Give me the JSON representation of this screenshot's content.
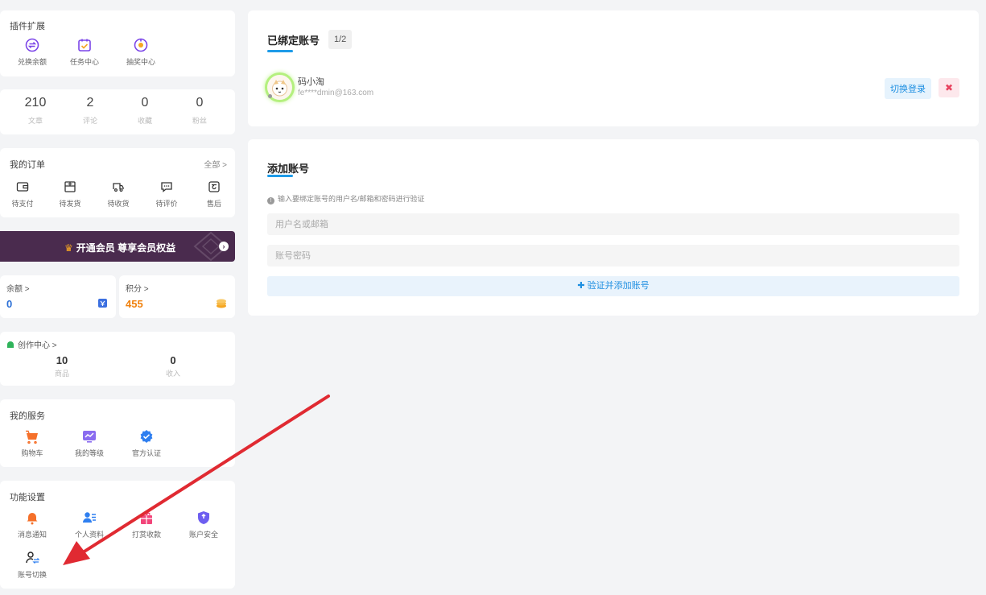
{
  "plugins": {
    "title": "插件扩展",
    "items": [
      {
        "label": "兑换余额",
        "icon": "exchange-icon"
      },
      {
        "label": "任务中心",
        "icon": "calendar-check-icon"
      },
      {
        "label": "抽奖中心",
        "icon": "lottery-icon"
      }
    ]
  },
  "stats": [
    {
      "value": "210",
      "label": "文章"
    },
    {
      "value": "2",
      "label": "评论"
    },
    {
      "value": "0",
      "label": "收藏"
    },
    {
      "value": "0",
      "label": "粉丝"
    }
  ],
  "orders": {
    "title": "我的订单",
    "all_label": "全部 >",
    "items": [
      {
        "label": "待支付",
        "icon": "wallet-icon"
      },
      {
        "label": "待发货",
        "icon": "box-icon"
      },
      {
        "label": "待收货",
        "icon": "truck-icon"
      },
      {
        "label": "待评价",
        "icon": "comment-icon"
      },
      {
        "label": "售后",
        "icon": "return-icon"
      }
    ]
  },
  "vip": {
    "label": "开通会员 尊享会员权益"
  },
  "balance": {
    "label": "余额 >",
    "value": "0"
  },
  "points": {
    "label": "积分 >",
    "value": "455"
  },
  "creator": {
    "title": "创作中心 >",
    "items": [
      {
        "value": "10",
        "label": "商品"
      },
      {
        "value": "0",
        "label": "收入"
      }
    ]
  },
  "services": {
    "title": "我的服务",
    "items": [
      {
        "label": "购物车",
        "icon": "cart-icon"
      },
      {
        "label": "我的等级",
        "icon": "level-chart-icon"
      },
      {
        "label": "官方认证",
        "icon": "verified-icon"
      }
    ]
  },
  "settings": {
    "title": "功能设置",
    "items": [
      {
        "label": "消息通知",
        "icon": "bell-icon"
      },
      {
        "label": "个人资料",
        "icon": "profile-icon"
      },
      {
        "label": "打赏收款",
        "icon": "gift-icon"
      },
      {
        "label": "账户安全",
        "icon": "shield-icon"
      },
      {
        "label": "账号切换",
        "icon": "switch-user-icon"
      }
    ]
  },
  "bound": {
    "title": "已绑定账号",
    "count": "1/2",
    "account": {
      "name": "码小淘",
      "email": "fe****dmin@163.com"
    },
    "switch_label": "切换登录",
    "delete_label": "✖"
  },
  "add": {
    "title": "添加账号",
    "hint": "输入要绑定账号的用户名/邮箱和密码进行验证",
    "username_placeholder": "用户名或邮箱",
    "password_placeholder": "账号密码",
    "submit_label": "✚ 验证并添加账号"
  },
  "colors": {
    "accent": "#1e9be8",
    "vip_bg": "#4a2b4e",
    "balance": "#2b6fd6",
    "points": "#f0820f",
    "arrow": "#e02a32"
  }
}
